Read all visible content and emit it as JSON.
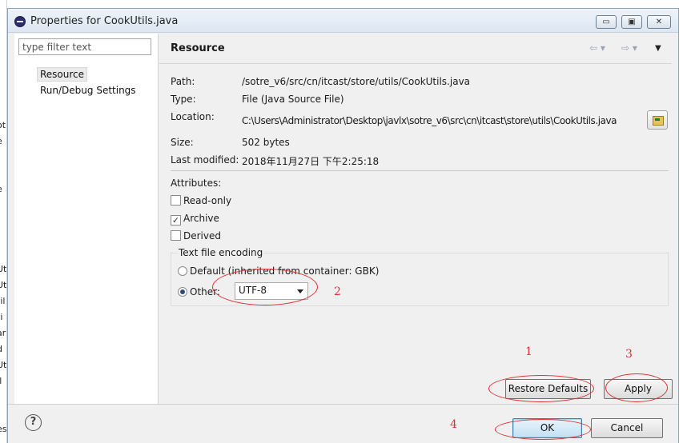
{
  "window": {
    "title": "Properties for CookUtils.java",
    "minimize": "▭",
    "maximize": "▣",
    "close": "✕"
  },
  "behind_glyphs": [
    "ot",
    "e",
    "e",
    "Ut",
    "Ut",
    "til",
    "ti",
    "ar",
    "d",
    "Ut",
    "Il",
    "es"
  ],
  "tree": {
    "filter_placeholder": "type filter text",
    "items": [
      "Resource",
      "Run/Debug Settings"
    ]
  },
  "header": {
    "title": "Resource",
    "back": "⇦ ▾",
    "forward": "⇨ ▾",
    "menu": "▼"
  },
  "props": {
    "path_label": "Path:",
    "path_value": "/sotre_v6/src/cn/itcast/store/utils/CookUtils.java",
    "type_label": "Type:",
    "type_value": "File  (Java Source File)",
    "location_label": "Location:",
    "location_value": "C:\\Users\\Administrator\\Desktop\\javlx\\sotre_v6\\src\\cn\\itcast\\store\\utils\\CookUtils.java",
    "size_label": "Size:",
    "size_value": "502  bytes",
    "modified_label": "Last modified:",
    "modified_value": "2018年11月27日 下午2:25:18"
  },
  "attributes": {
    "label": "Attributes:",
    "read_only": "Read-only",
    "archive": "Archive",
    "archive_checked": "✓",
    "derived": "Derived"
  },
  "encoding": {
    "group_title": "Text file encoding",
    "default_label": "Default (inherited from container: GBK)",
    "other_label": "Other:",
    "other_value": "UTF-8"
  },
  "buttons": {
    "restore": "Restore Defaults",
    "apply": "Apply",
    "ok": "OK",
    "cancel": "Cancel",
    "help": "?"
  },
  "annotations": {
    "n1": "1",
    "n2": "2",
    "n3": "3",
    "n4": "4"
  },
  "colors": {
    "annotation": "#e03030",
    "ok_border": "#3c7fb1"
  }
}
